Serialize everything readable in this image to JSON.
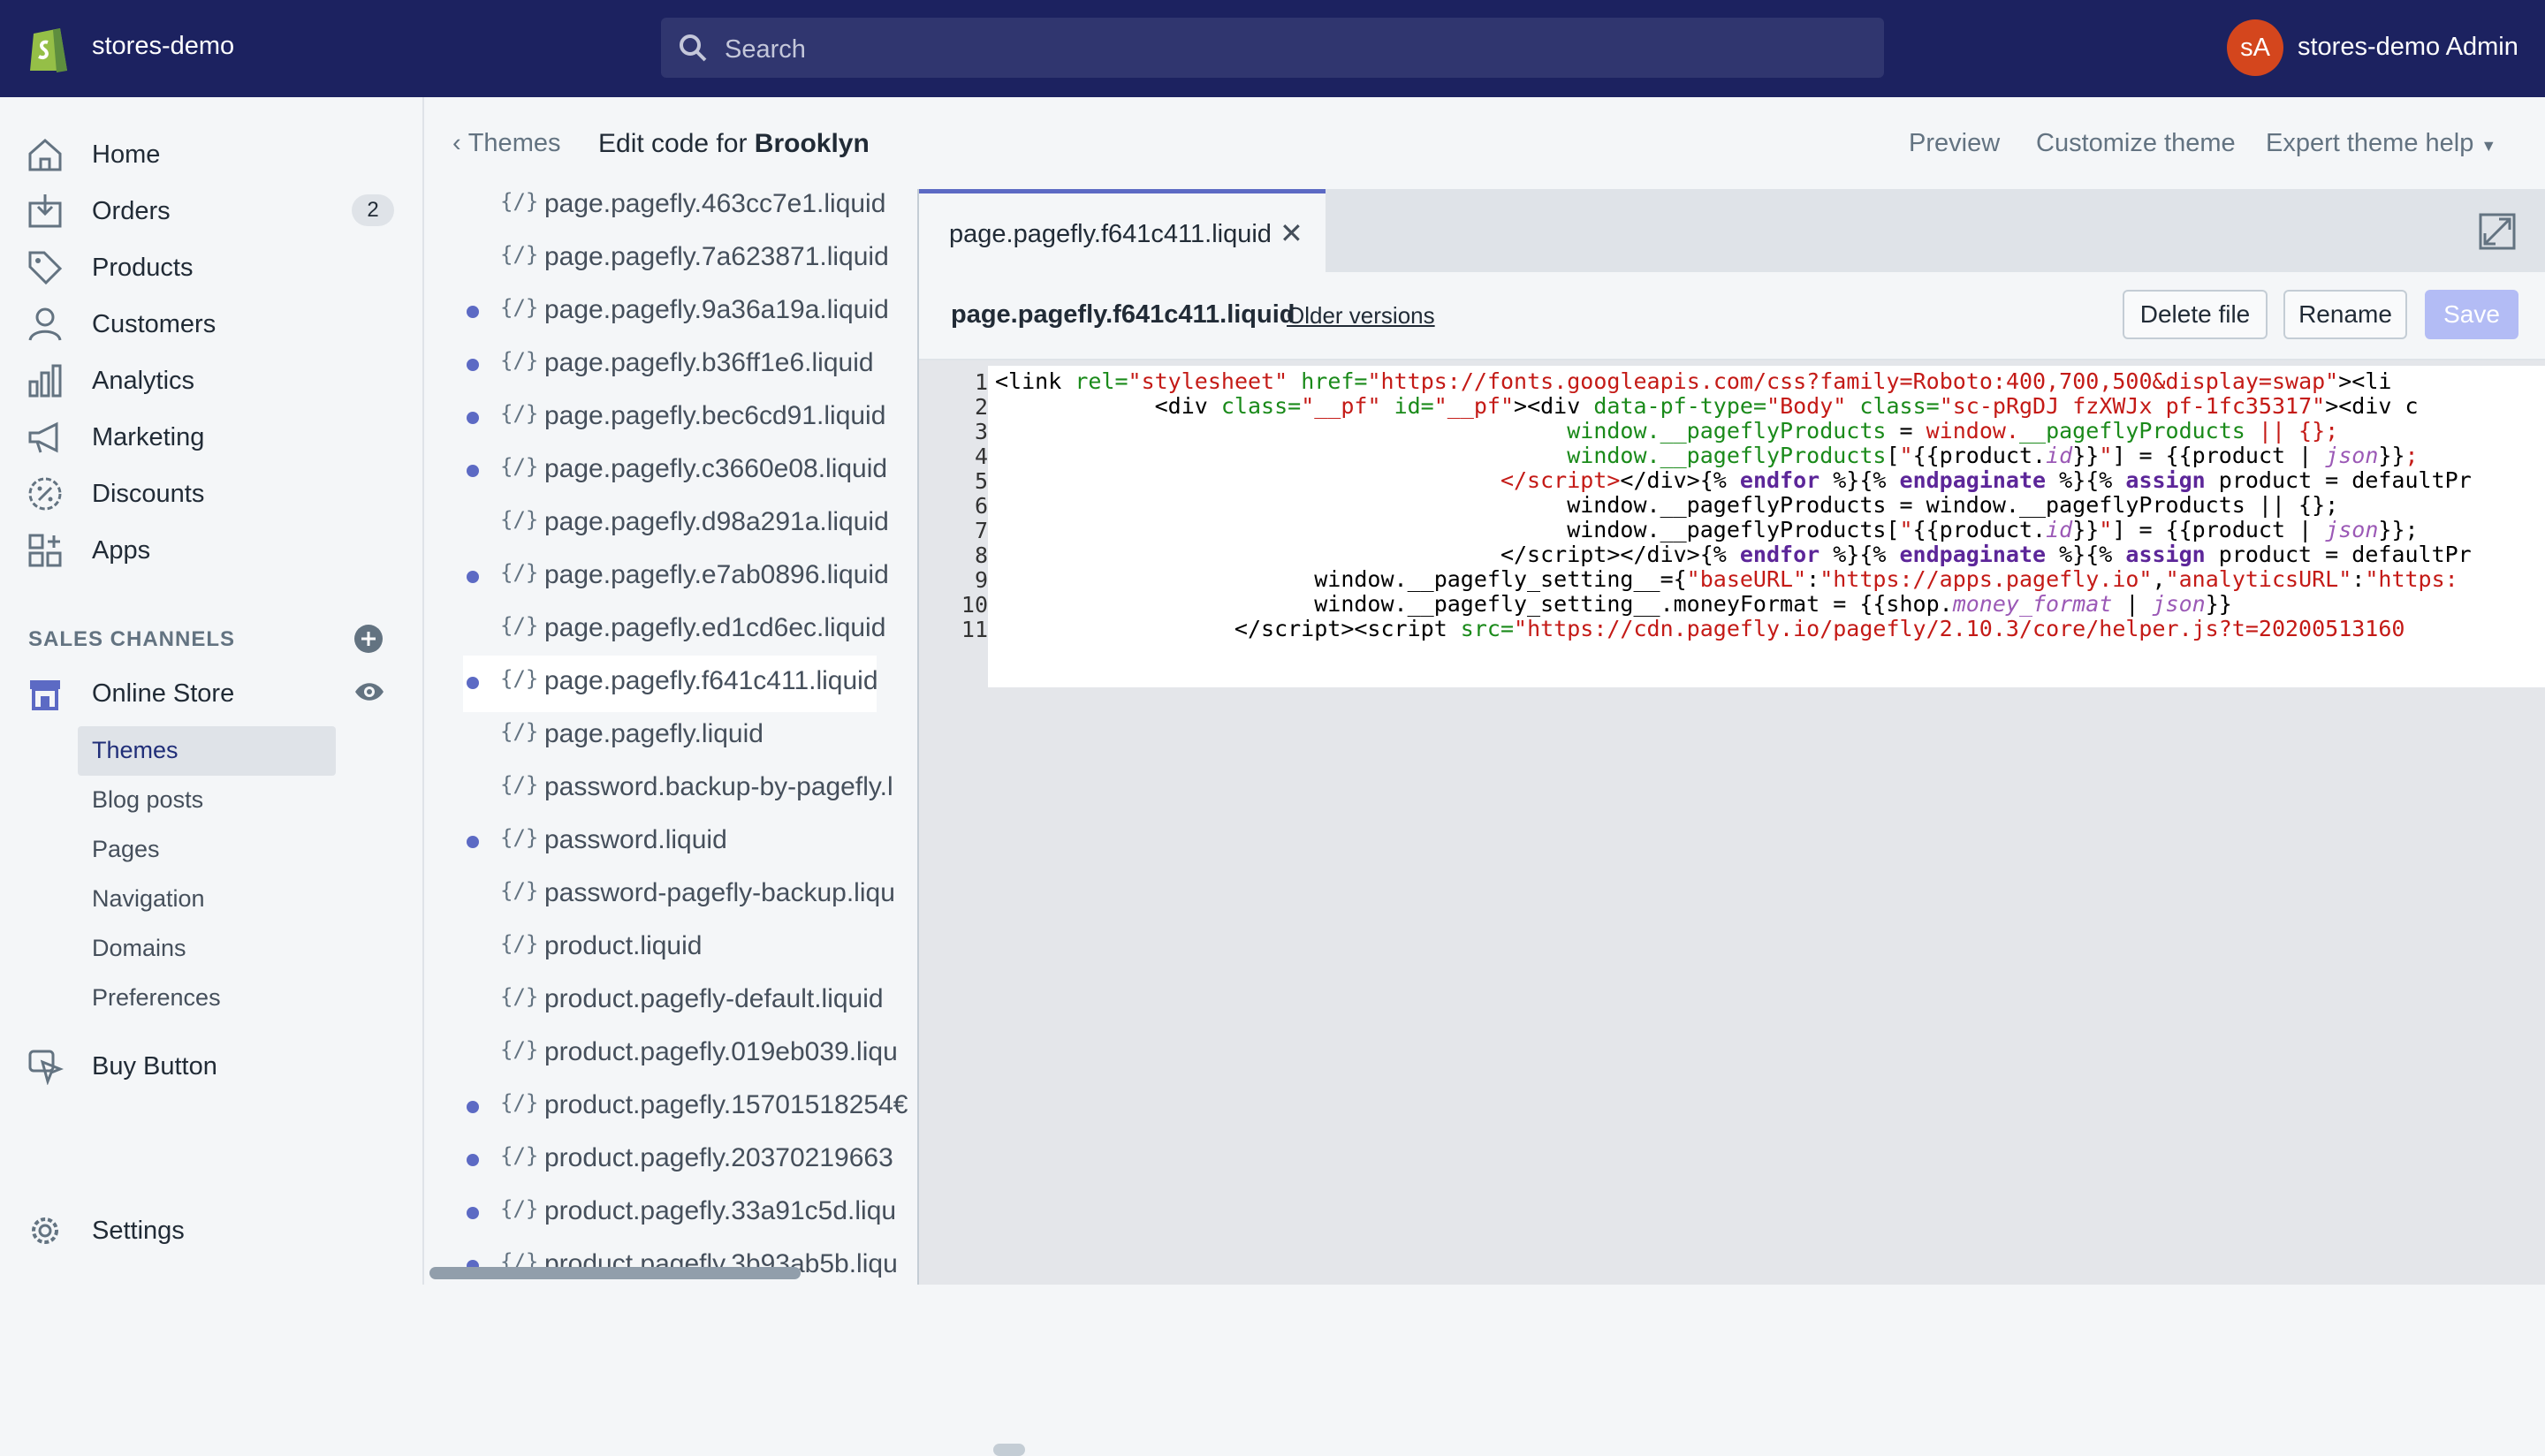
{
  "topbar": {
    "store_name": "stores-demo",
    "search_placeholder": "Search",
    "avatar_initials": "sA",
    "admin_name": "stores-demo Admin"
  },
  "sidebar": {
    "items": [
      {
        "label": "Home",
        "icon": "home-icon"
      },
      {
        "label": "Orders",
        "icon": "orders-icon",
        "badge": "2"
      },
      {
        "label": "Products",
        "icon": "tag-icon"
      },
      {
        "label": "Customers",
        "icon": "person-icon"
      },
      {
        "label": "Analytics",
        "icon": "bar-chart-icon"
      },
      {
        "label": "Marketing",
        "icon": "megaphone-icon"
      },
      {
        "label": "Discounts",
        "icon": "discount-icon"
      },
      {
        "label": "Apps",
        "icon": "apps-icon"
      }
    ],
    "sales_channels_title": "SALES CHANNELS",
    "online_store": "Online Store",
    "subitems": [
      "Themes",
      "Blog posts",
      "Pages",
      "Navigation",
      "Domains",
      "Preferences"
    ],
    "buy_button": "Buy Button",
    "settings": "Settings"
  },
  "header": {
    "back_label": "Themes",
    "edit_prefix": "Edit code for",
    "theme_name": "Brooklyn",
    "preview": "Preview",
    "customize": "Customize theme",
    "expert_help": "Expert theme help"
  },
  "files": [
    {
      "name": "page.pagefly.463cc7e1.liquid",
      "dot": false
    },
    {
      "name": "page.pagefly.7a623871.liquid",
      "dot": false
    },
    {
      "name": "page.pagefly.9a36a19a.liquid",
      "dot": true
    },
    {
      "name": "page.pagefly.b36ff1e6.liquid",
      "dot": true
    },
    {
      "name": "page.pagefly.bec6cd91.liquid",
      "dot": true
    },
    {
      "name": "page.pagefly.c3660e08.liquid",
      "dot": true
    },
    {
      "name": "page.pagefly.d98a291a.liquid",
      "dot": false
    },
    {
      "name": "page.pagefly.e7ab0896.liquid",
      "dot": true
    },
    {
      "name": "page.pagefly.ed1cd6ec.liquid",
      "dot": false
    },
    {
      "name": "page.pagefly.f641c411.liquid",
      "dot": true
    },
    {
      "name": "page.pagefly.liquid",
      "dot": false
    },
    {
      "name": "password.backup-by-pagefly.l",
      "dot": false
    },
    {
      "name": "password.liquid",
      "dot": true
    },
    {
      "name": "password-pagefly-backup.liqu",
      "dot": false
    },
    {
      "name": "product.liquid",
      "dot": false
    },
    {
      "name": "product.pagefly-default.liquid",
      "dot": false
    },
    {
      "name": "product.pagefly.019eb039.liqu",
      "dot": false
    },
    {
      "name": "product.pagefly.15701518254€",
      "dot": true
    },
    {
      "name": "product.pagefly.20370219663",
      "dot": true
    },
    {
      "name": "product.pagefly.33a91c5d.liqu",
      "dot": true
    },
    {
      "name": "product.pagefly.3b93ab5b.liqu",
      "dot": true
    }
  ],
  "file_icon": "{/}",
  "editor": {
    "tab_name": "page.pagefly.f641c411.liquid",
    "file_title": "page.pagefly.f641c411.liquid",
    "older_versions": "Older versions",
    "delete": "Delete file",
    "rename": "Rename",
    "save": "Save",
    "line_numbers": [
      "1",
      "2",
      "3",
      "4",
      "5",
      "6",
      "7",
      "8",
      "9",
      "10",
      "11"
    ]
  },
  "colors": {
    "topbar": "#1c2260",
    "accent": "#5c6ac4",
    "avatar": "#d4461d"
  }
}
